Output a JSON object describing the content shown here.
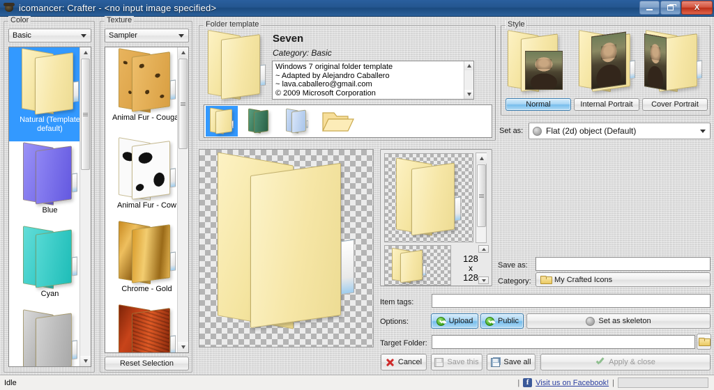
{
  "window": {
    "title": "icomancer: Crafter - <no input image specified>",
    "icon": "app-icon",
    "minimize_label": "Minimize",
    "restore_label": "Restore",
    "close_label": "X"
  },
  "color_panel": {
    "legend": "Color",
    "dropdown_value": "Basic",
    "items": [
      {
        "label": "Natural (Template default)",
        "swatch": "natural",
        "selected": true
      },
      {
        "label": "Blue",
        "swatch": "blue",
        "selected": false
      },
      {
        "label": "Cyan",
        "swatch": "cyan",
        "selected": false
      },
      {
        "label": "",
        "swatch": "gray",
        "selected": false
      }
    ]
  },
  "texture_panel": {
    "legend": "Texture",
    "dropdown_value": "Sampler",
    "items": [
      {
        "label": "Animal Fur - Cougar",
        "swatch": "cougar"
      },
      {
        "label": "Animal Fur - Cow",
        "swatch": "cow"
      },
      {
        "label": "Chrome - Gold",
        "swatch": "gold"
      },
      {
        "label": "",
        "swatch": "rust"
      }
    ],
    "reset_button": "Reset Selection"
  },
  "template_panel": {
    "legend": "Folder template",
    "name": "Seven",
    "category": "Category: Basic",
    "description": [
      "Windows 7 original folder template",
      "~ Adapted by Alejandro Caballero",
      "~ lava.caballero@gmail.com",
      "© 2009 Microsoft Corporation"
    ],
    "thumbnails": [
      {
        "name": "folder-yellow",
        "selected": true
      },
      {
        "name": "folder-green",
        "selected": false
      },
      {
        "name": "folder-glass",
        "selected": false
      },
      {
        "name": "folder-classic-open",
        "selected": false
      }
    ]
  },
  "style_panel": {
    "legend": "Style",
    "buttons": [
      {
        "label": "Normal",
        "selected": true
      },
      {
        "label": "Internal Portrait",
        "selected": false
      },
      {
        "label": "Cover Portrait",
        "selected": false
      }
    ],
    "set_as_label": "Set as:",
    "set_as_value": "Flat (2d) object (Default)"
  },
  "preview": {
    "size_label_top": "128",
    "size_label_mid": "x",
    "size_label_bottom": "128"
  },
  "form": {
    "save_as_label": "Save as:",
    "save_as_value": "",
    "category_label": "Category:",
    "category_value": "My Crafted Icons",
    "item_tags_label": "Item tags:",
    "item_tags_value": "",
    "options_label": "Options:",
    "upload_button": "Upload",
    "public_button": "Public",
    "skeleton_button": "Set as skeleton",
    "target_folder_label": "Target Folder:",
    "target_folder_value": "",
    "browse_button": "browse-folder-icon"
  },
  "actions": {
    "cancel": "Cancel",
    "save_this": "Save this",
    "save_all": "Save all",
    "apply_close": "Apply & close"
  },
  "statusbar": {
    "status_text": "Idle",
    "separator": "|",
    "facebook_text": "Visit us on Facebook!",
    "facebook_icon": "f"
  }
}
